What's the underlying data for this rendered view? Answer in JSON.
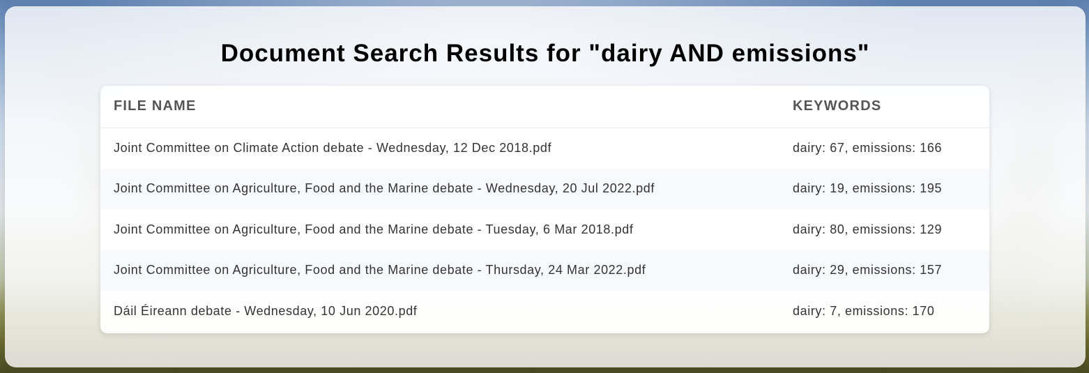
{
  "page": {
    "title": "Document Search Results for \"dairy AND emissions\""
  },
  "table": {
    "headers": {
      "file_name": "File Name",
      "keywords": "Keywords"
    },
    "rows": [
      {
        "file_name": "Joint Committee on Climate Action debate - Wednesday, 12 Dec 2018.pdf",
        "keywords": "dairy: 67, emissions: 166"
      },
      {
        "file_name": "Joint Committee on Agriculture, Food and the Marine debate - Wednesday, 20 Jul 2022.pdf",
        "keywords": "dairy: 19, emissions: 195"
      },
      {
        "file_name": "Joint Committee on Agriculture, Food and the Marine debate - Tuesday, 6 Mar 2018.pdf",
        "keywords": "dairy: 80, emissions: 129"
      },
      {
        "file_name": "Joint Committee on Agriculture, Food and the Marine debate - Thursday, 24 Mar 2022.pdf",
        "keywords": "dairy: 29, emissions: 157"
      },
      {
        "file_name": "Dáil Éireann debate - Wednesday, 10 Jun 2020.pdf",
        "keywords": "dairy: 7, emissions: 170"
      }
    ]
  }
}
